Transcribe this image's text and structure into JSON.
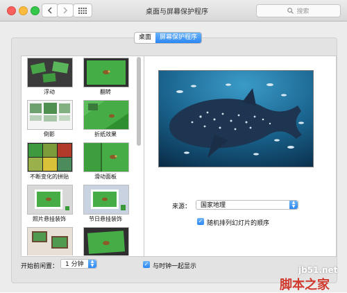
{
  "window": {
    "title": "桌面与屏幕保护程序",
    "search_placeholder": "搜索"
  },
  "tabs": [
    {
      "label": "桌面",
      "active": false
    },
    {
      "label": "屏幕保护程序",
      "active": true
    }
  ],
  "screensavers": [
    {
      "label": "浮动",
      "thumb": "floating"
    },
    {
      "label": "翻转",
      "thumb": "flip"
    },
    {
      "label": "倒影",
      "thumb": "reflection"
    },
    {
      "label": "折纸效果",
      "thumb": "origami"
    },
    {
      "label": "不断变化的拼贴",
      "thumb": "collage"
    },
    {
      "label": "滑动面板",
      "thumb": "panels"
    },
    {
      "label": "照片悬挂装饰",
      "thumb": "photo-mobile"
    },
    {
      "label": "节日悬挂装饰",
      "thumb": "holiday-mobile"
    }
  ],
  "options": {
    "source_label": "来源：",
    "source_value": "国家地理",
    "shuffle_label": "随机排列幻灯片的顺序",
    "shuffle_checked": true
  },
  "footer": {
    "idle_label": "开始前闲置：",
    "idle_value": "1 分钟",
    "show_clock_label": "与时钟一起显示",
    "show_clock_checked": true
  },
  "watermark": {
    "site": "jb51.net",
    "name": "脚本之家"
  },
  "colors": {
    "accent": "#2b87f2",
    "thumb_green": "#3aa83a",
    "preview_water": "#1f6f98"
  }
}
